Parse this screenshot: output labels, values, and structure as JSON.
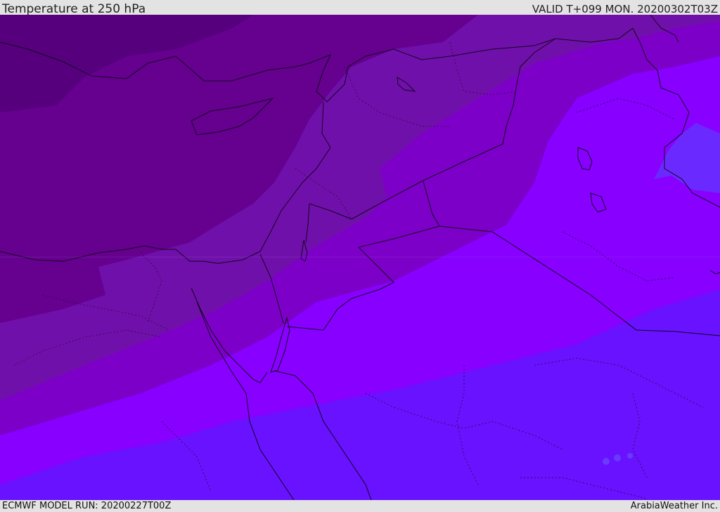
{
  "header": {
    "title": "Temperature at 250 hPa",
    "valid": "VALID T+099 MON. 20200302T03Z"
  },
  "footer": {
    "model_run": "ECMWF MODEL RUN: 20200227T00Z",
    "brand": "ArabiaWeather Inc."
  },
  "map": {
    "variable": "temperature",
    "level": "250 hPa",
    "colors": {
      "band_1_darkest": "#56007e",
      "band_2": "#65008f",
      "band_3": "#7010aa",
      "band_4": "#7d00c8",
      "band_5": "#8800ff",
      "band_6": "#6812ff",
      "border": "#1a0a2a"
    }
  }
}
